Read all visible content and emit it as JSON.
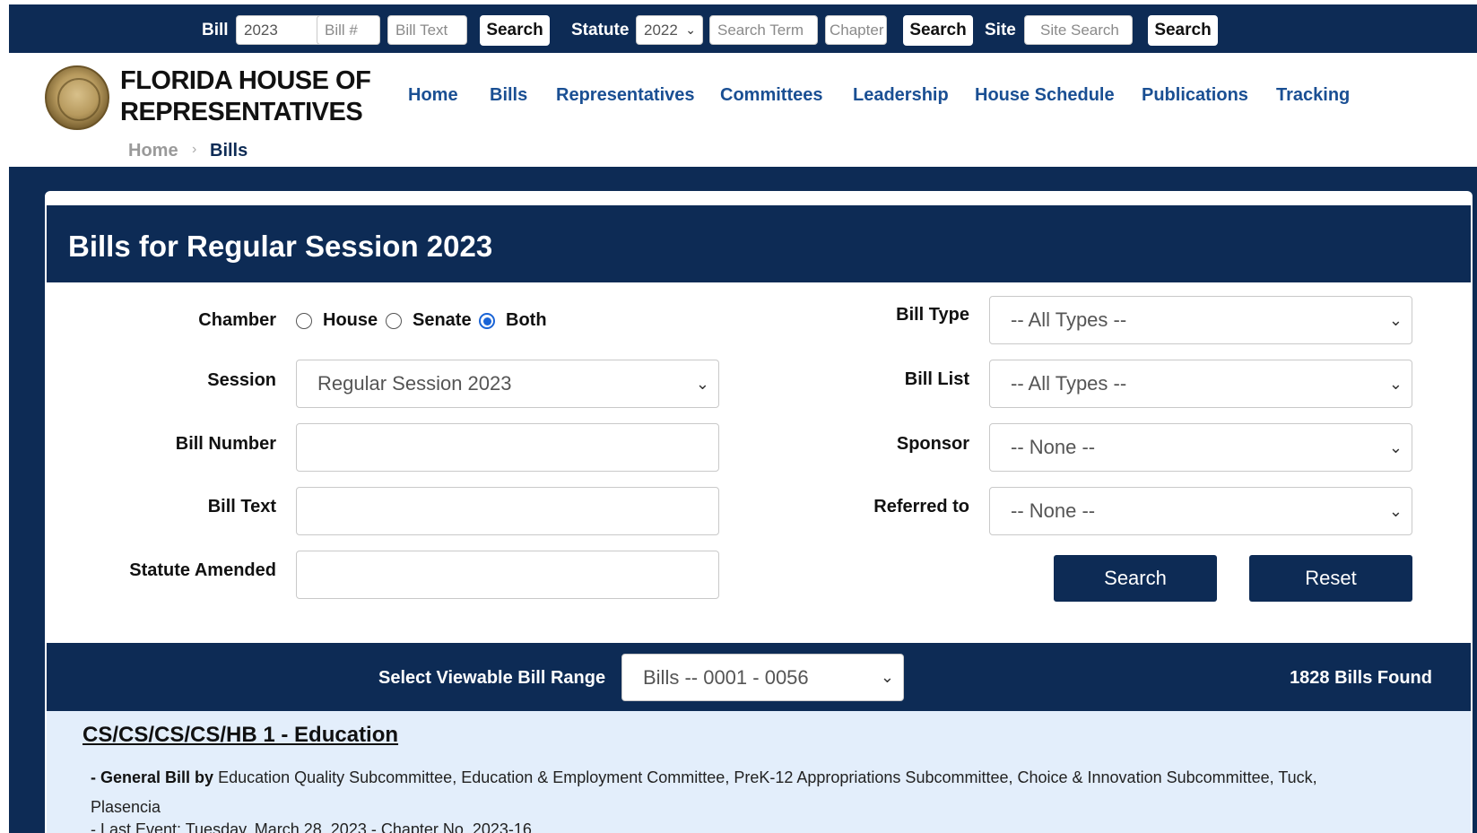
{
  "topbar": {
    "bill_label": "Bill",
    "bill_year": "2023",
    "bill_number_placeholder": "Bill #",
    "bill_text_placeholder": "Bill Text",
    "search_label": "Search",
    "statute_label": "Statute",
    "statute_year": "2022",
    "search_term_placeholder": "Search Term",
    "chapter_placeholder": "Chapter",
    "site_label": "Site",
    "site_search_placeholder": "Site Search"
  },
  "header": {
    "brand_line1": "FLORIDA HOUSE OF",
    "brand_line2": "REPRESENTATIVES",
    "nav": [
      "Home",
      "Bills",
      "Representatives",
      "Committees",
      "Leadership",
      "House Schedule",
      "Publications",
      "Tracking"
    ],
    "breadcrumb": {
      "home": "Home",
      "separator": "›",
      "current": "Bills"
    }
  },
  "form": {
    "title": "Bills for Regular Session 2023",
    "chamber_label": "Chamber",
    "chamber_options": [
      "House",
      "Senate",
      "Both"
    ],
    "chamber_selected": "Both",
    "session_label": "Session",
    "session_value": "Regular Session 2023",
    "bill_number_label": "Bill Number",
    "bill_text_label": "Bill Text",
    "statute_amended_label": "Statute Amended",
    "bill_type_label": "Bill Type",
    "bill_type_value": "-- All Types --",
    "bill_list_label": "Bill List",
    "bill_list_value": "-- All Types --",
    "sponsor_label": "Sponsor",
    "sponsor_value": "-- None --",
    "referred_label": "Referred to",
    "referred_value": "-- None --",
    "search_button": "Search",
    "reset_button": "Reset"
  },
  "results": {
    "range_label": "Select Viewable Bill Range",
    "range_value": "Bills -- 0001 - 0056",
    "found": "1828 Bills Found",
    "first_bill": {
      "title": "CS/CS/CS/CS/HB 1 - Education",
      "type_prefix": "- General Bill by",
      "sponsors": "Education Quality Subcommittee, Education & Employment Committee, PreK-12 Appropriations Subcommittee, Choice & Innovation Subcommittee, Tuck, Plasencia",
      "status_line": "- Last Event: Tuesday, March 28, 2023 - Chapter No. 2023-16"
    }
  },
  "colors": {
    "navy": "#0d2b55",
    "nav_link": "#1a4f93",
    "bill_bg": "#e3eefb",
    "radio": "#1a64d6"
  }
}
